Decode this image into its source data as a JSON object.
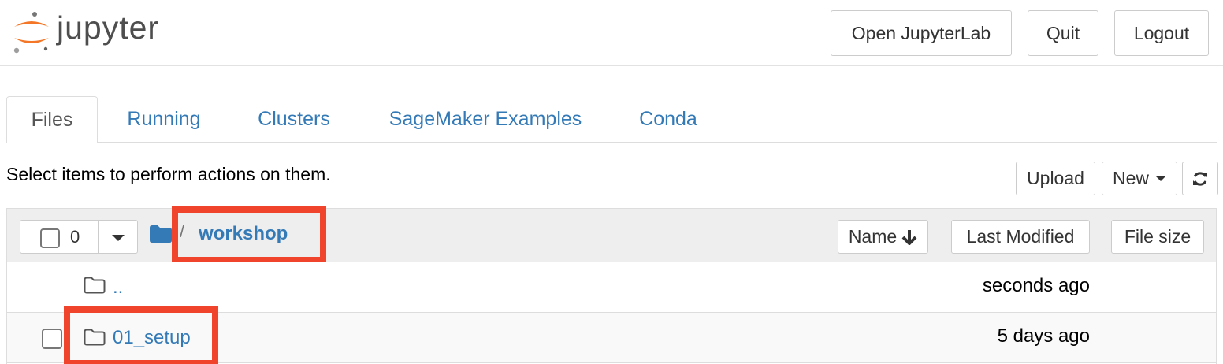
{
  "header": {
    "logo_text": "jupyter",
    "buttons": {
      "open_jupyterlab": "Open JupyterLab",
      "quit": "Quit",
      "logout": "Logout"
    }
  },
  "tabs": [
    "Files",
    "Running",
    "Clusters",
    "SageMaker Examples",
    "Conda"
  ],
  "toolbar": {
    "hint": "Select items to perform actions on them.",
    "upload": "Upload",
    "new": "New"
  },
  "list": {
    "selected_count": "0",
    "breadcrumb": "workshop",
    "sort_buttons": {
      "name": "Name",
      "last_modified": "Last Modified",
      "file_size": "File size"
    },
    "rows": [
      {
        "name": "..",
        "modified": "seconds ago"
      },
      {
        "name": "01_setup",
        "modified": "5 days ago"
      }
    ]
  },
  "colors": {
    "link": "#337ab7",
    "highlight": "#f0442c",
    "logo_orange": "#f37726"
  },
  "icons": [
    "jupyter-logo",
    "folder-icon",
    "caret-down-icon",
    "arrow-down-icon",
    "refresh-icon"
  ]
}
